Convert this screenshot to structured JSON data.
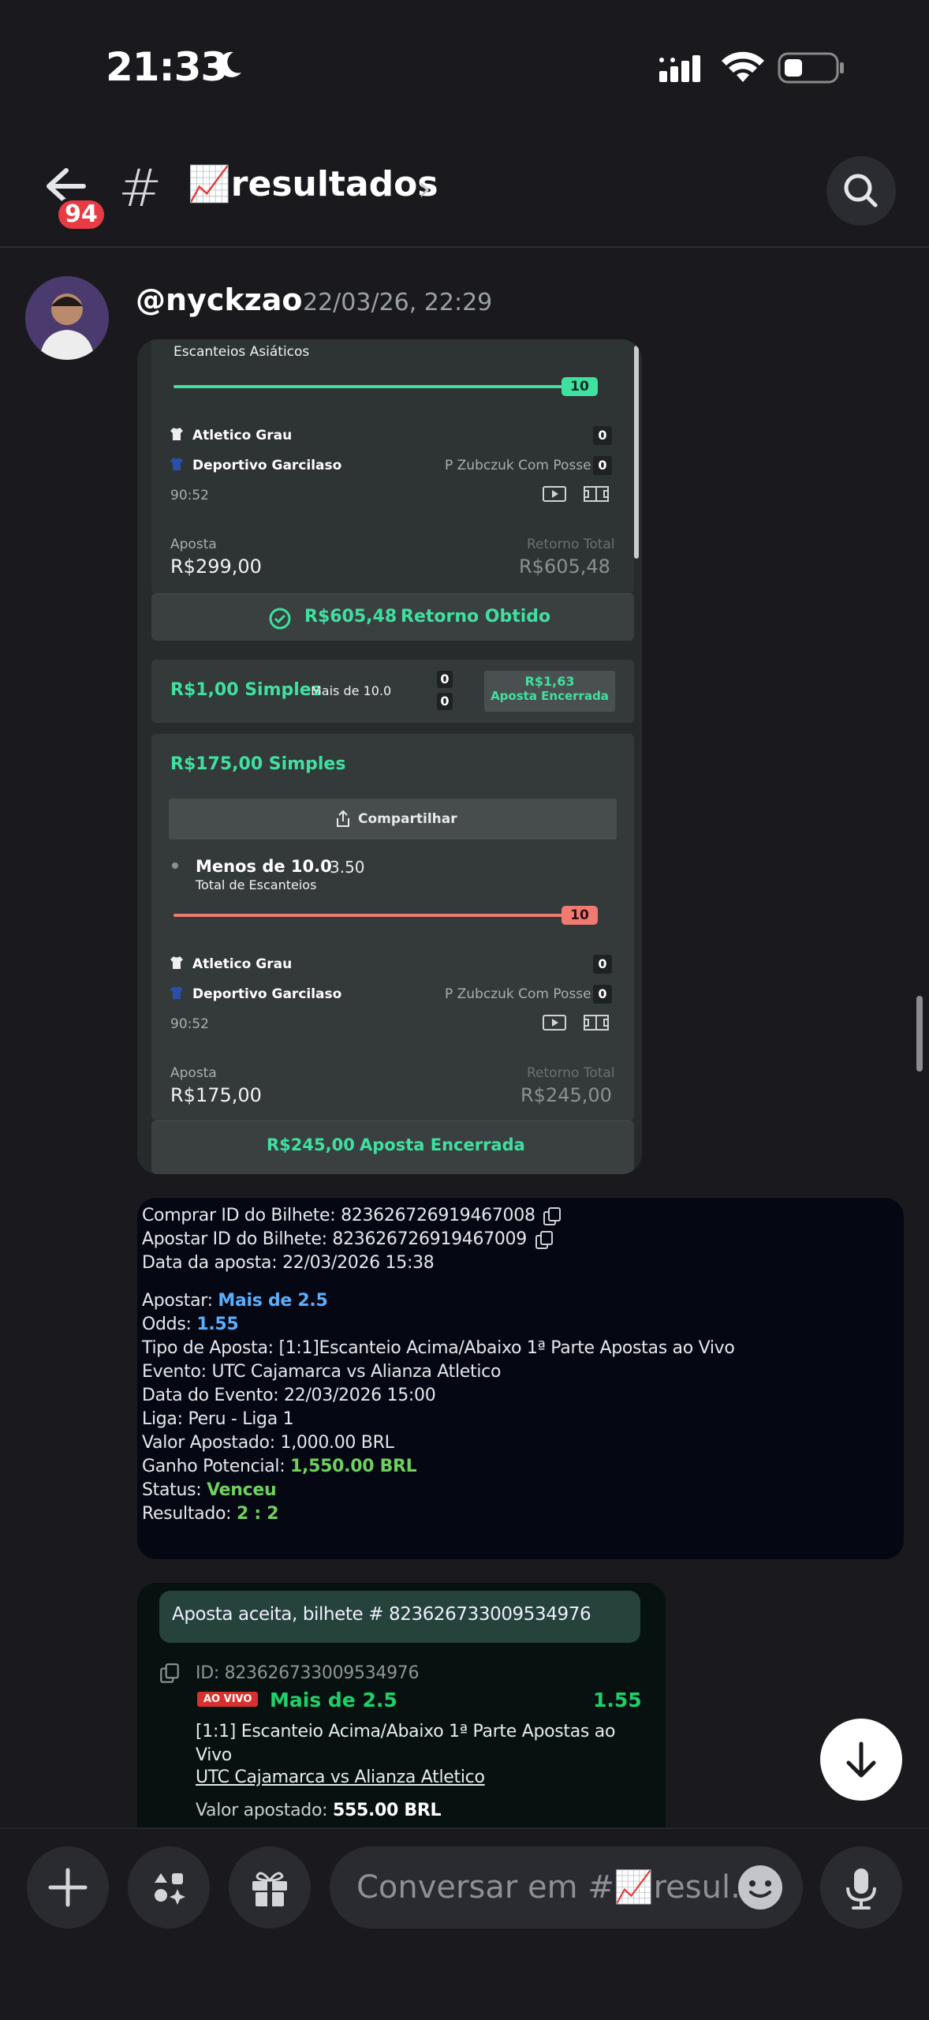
{
  "status_bar": {
    "time": "21:33"
  },
  "header": {
    "unread_count": "94",
    "channel_name": "📈resultados"
  },
  "message": {
    "username": "@nyckzao",
    "timestamp": "22/03/26, 22:29"
  },
  "bet_slip_1": {
    "market_top": "Escanteios Asiáticos",
    "line_top": "10",
    "team_home": "Atletico Grau",
    "team_away": "Deportivo Garcilaso",
    "score_home": "0",
    "score_away": "0",
    "player_tag": "P Zubczuk Com Posse",
    "match_time": "90:52",
    "stake_label": "Aposta",
    "stake_value": "R$299,00",
    "return_label": "Retorno Total",
    "return_value": "R$605,48",
    "obtained_amount": "R$605,48",
    "obtained_label": "Retorno Obtido",
    "simple_amount": "R$1,00 Simples",
    "simple_market": "Mais de 10.0",
    "simple_score_home": "0",
    "simple_score_away": "0",
    "simple_return": "R$1,63",
    "simple_status": "Aposta Encerrada",
    "bet2_title": "R$175,00 Simples",
    "share_label": "Compartilhar",
    "bet2_selection": "Menos de 10.0",
    "bet2_odds": "3.50",
    "bet2_market": "Total de Escanteios",
    "bet2_line": "10",
    "bet2_team_home": "Atletico Grau",
    "bet2_team_away": "Deportivo Garcilaso",
    "bet2_score_home": "0",
    "bet2_score_away": "0",
    "bet2_player_tag": "P Zubczuk Com Posse",
    "bet2_match_time": "90:52",
    "bet2_stake_label": "Aposta",
    "bet2_stake_value": "R$175,00",
    "bet2_return_label": "Retorno Total",
    "bet2_return_value": "R$245,00",
    "bet2_footer_amount": "R$245,00",
    "bet2_footer_label": "Aposta Encerrada"
  },
  "ticket": {
    "buy_id_label": "Comprar ID do Bilhete:",
    "buy_id": "823626726919467008",
    "bet_id_label": "Apostar ID do Bilhete:",
    "bet_id": "823626726919467009",
    "date_label": "Data da aposta:",
    "date": "22/03/2026 15:38",
    "bet_label": "Apostar:",
    "bet": "Mais de 2.5",
    "odds_label": "Odds:",
    "odds": "1.55",
    "type_label": "Tipo de Aposta:",
    "type": "[1:1]Escanteio Acima/Abaixo 1ª Parte Apostas ao Vivo",
    "event_label": "Evento:",
    "event": "UTC Cajamarca vs Alianza Atletico",
    "event_date_label": "Data do Evento:",
    "event_date": "22/03/2026 15:00",
    "league_label": "Liga:",
    "league": "Peru - Liga 1",
    "stake_label": "Valor Apostado:",
    "stake": "1,000.00 BRL",
    "potential_label": "Ganho Potencial:",
    "potential": "1,550.00 BRL",
    "status_label": "Status:",
    "status": "Venceu",
    "result_label": "Resultado:",
    "result": "2 : 2"
  },
  "accepted": {
    "header": "Aposta aceita, bilhete # 823626733009534976",
    "id_line": "ID: 823626733009534976",
    "live_badge": "AO VIVO",
    "selection": "Mais de 2.5",
    "odds": "1.55",
    "market": "[1:1] Escanteio Acima/Abaixo 1ª Parte Apostas ao Vivo",
    "event": "UTC Cajamarca vs Alianza Atletico",
    "stake_label": "Valor apostado:",
    "stake": "555.00 BRL"
  },
  "composer": {
    "placeholder": "Conversar em #📈resul..."
  },
  "colors": {
    "accent_green": "#3fe0a0",
    "badge_red": "#e83b44",
    "line_red": "#f07a72"
  }
}
